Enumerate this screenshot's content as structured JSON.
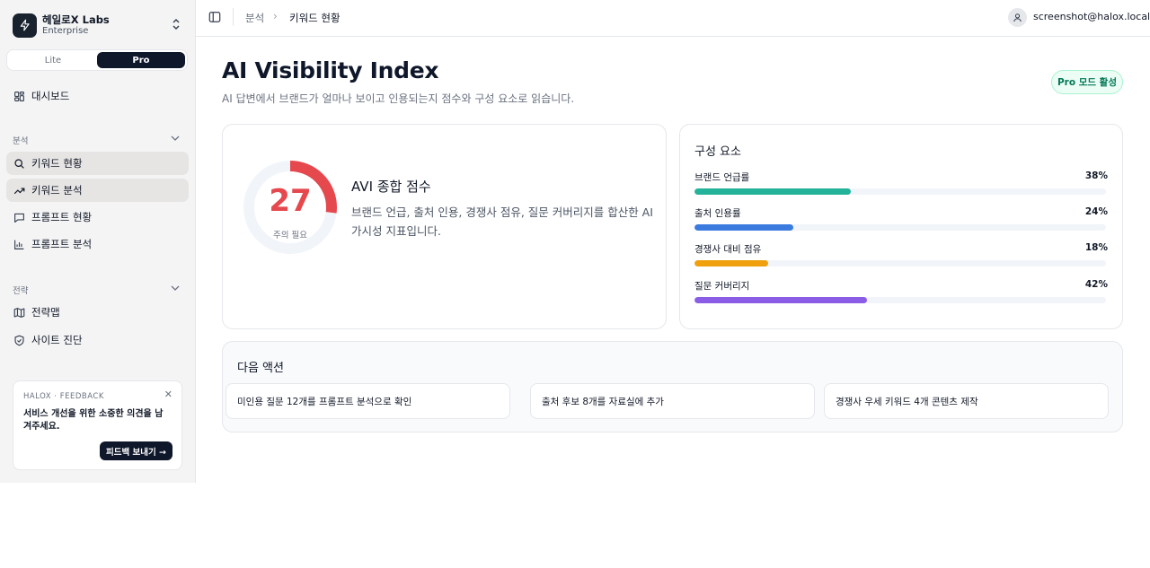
{
  "workspace": {
    "name": "헤일로X Labs",
    "plan": "Enterprise"
  },
  "plan_toggle": {
    "options": [
      "Lite",
      "Pro"
    ],
    "selected": "Pro"
  },
  "sidebar": {
    "dashboard": "대시보드",
    "sections": [
      {
        "label": "분석",
        "items": [
          "키워드 현황",
          "키워드 분석",
          "프롬프트 현황",
          "프롬프트 분석"
        ]
      },
      {
        "label": "전략",
        "items": [
          "전략맵",
          "사이트 진단"
        ]
      }
    ],
    "feedback": {
      "tag": "HALOX · FEEDBACK",
      "message": "서비스 개선을 위한 소중한 의견을 남겨주세요.",
      "button": "피드백 보내기 →"
    }
  },
  "topbar": {
    "breadcrumb": [
      "분석",
      "키워드 현황"
    ],
    "user_email": "screenshot@halox.local"
  },
  "page": {
    "title": "AI Visibility Index",
    "subtitle": "AI 답변에서 브랜드가 얼마나 보이고 인용되는지 점수와 구성 요소로 읽습니다.",
    "badge": "Pro 모드 활성"
  },
  "score": {
    "value": 27,
    "max": 100,
    "status": "주의 필요",
    "title": "AVI 종합 점수",
    "description": "브랜드 언급, 출처 인용, 경쟁사 점유, 질문 커버리지를 합산한 AI 가시성 지표입니다.",
    "color": "#e5484d"
  },
  "components": {
    "title": "구성 요소",
    "items": [
      {
        "label": "브랜드 언급률",
        "value": "38%",
        "pct": 38,
        "color": "#22b39a"
      },
      {
        "label": "출처 인용률",
        "value": "24%",
        "pct": 24,
        "color": "#3b7be0"
      },
      {
        "label": "경쟁사 대비 점유",
        "value": "18%",
        "pct": 18,
        "color": "#f0a00c"
      },
      {
        "label": "질문 커버리지",
        "value": "42%",
        "pct": 42,
        "color": "#8b5ce6"
      }
    ]
  },
  "next_actions": {
    "title": "다음 액션",
    "items": [
      "미인용 질문 12개를 프롬프트 분석으로 확인",
      "출처 후보 8개를 자료실에 추가",
      "경쟁사 우세 키워드 4개 콘텐츠 제작"
    ]
  }
}
